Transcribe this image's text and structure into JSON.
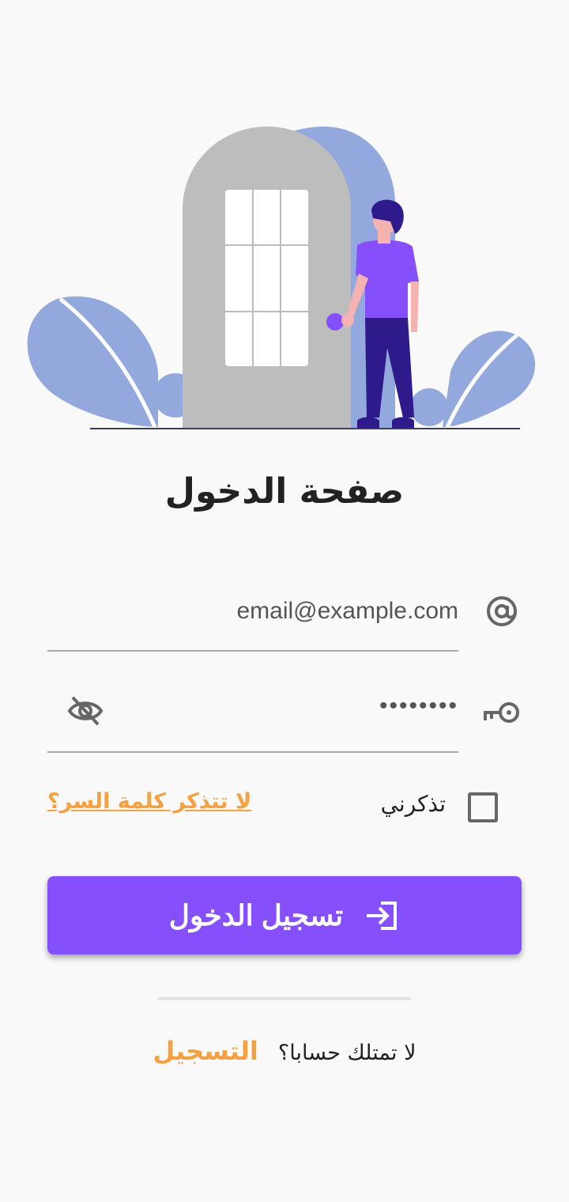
{
  "header": {
    "title": "صفحة الدخول"
  },
  "form": {
    "email_value": "email@example.com",
    "password_value": "••••••••",
    "remember_label": "تذكرني",
    "forgot_label": "لا تتذكر كلمة السر؟",
    "login_label": "تسجيل الدخول"
  },
  "footer": {
    "question": "لا تمتلك حسابا؟",
    "signup_label": "التسجيل"
  },
  "icons": {
    "email": "at-icon",
    "password": "key-icon",
    "visibility": "eye-off-icon",
    "login": "login-arrow-icon"
  },
  "colors": {
    "accent": "#8550fb",
    "link": "#f5a142",
    "illustration_blue": "#93a9de",
    "door_gray": "#bdbdbd",
    "background": "#f9f9f9"
  }
}
